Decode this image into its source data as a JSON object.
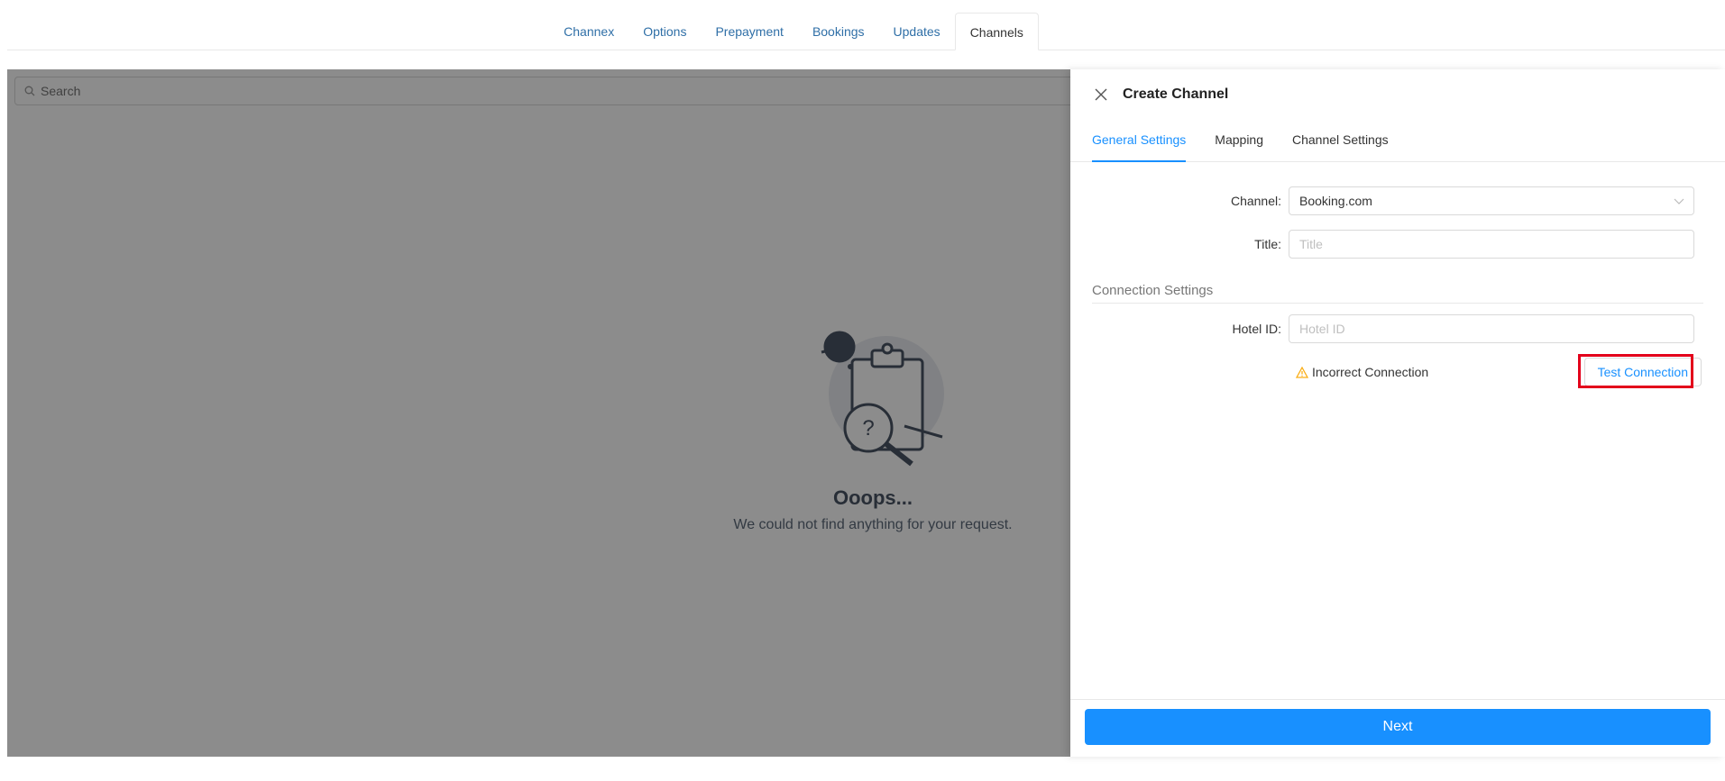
{
  "top_tabs": [
    {
      "label": "Channex"
    },
    {
      "label": "Options"
    },
    {
      "label": "Prepayment"
    },
    {
      "label": "Bookings"
    },
    {
      "label": "Updates"
    },
    {
      "label": "Channels"
    }
  ],
  "active_top_tab": "Channels",
  "search": {
    "placeholder": "Search"
  },
  "empty_state": {
    "title": "Ooops...",
    "subtitle": "We could not find anything for your request."
  },
  "drawer": {
    "title": "Create Channel",
    "tabs": [
      {
        "label": "General Settings"
      },
      {
        "label": "Mapping"
      },
      {
        "label": "Channel Settings"
      }
    ],
    "active_tab": "General Settings",
    "form": {
      "channel_label": "Channel:",
      "channel_value": "Booking.com",
      "title_label": "Title:",
      "title_placeholder": "Title",
      "section_title": "Connection Settings",
      "hotel_id_label": "Hotel ID:",
      "hotel_id_placeholder": "Hotel ID",
      "connection_status": "Incorrect Connection",
      "test_button": "Test Connection"
    },
    "next_button": "Next"
  },
  "colors": {
    "primary": "#1890ff",
    "warning": "#faad14",
    "highlight": "#e3001b"
  }
}
